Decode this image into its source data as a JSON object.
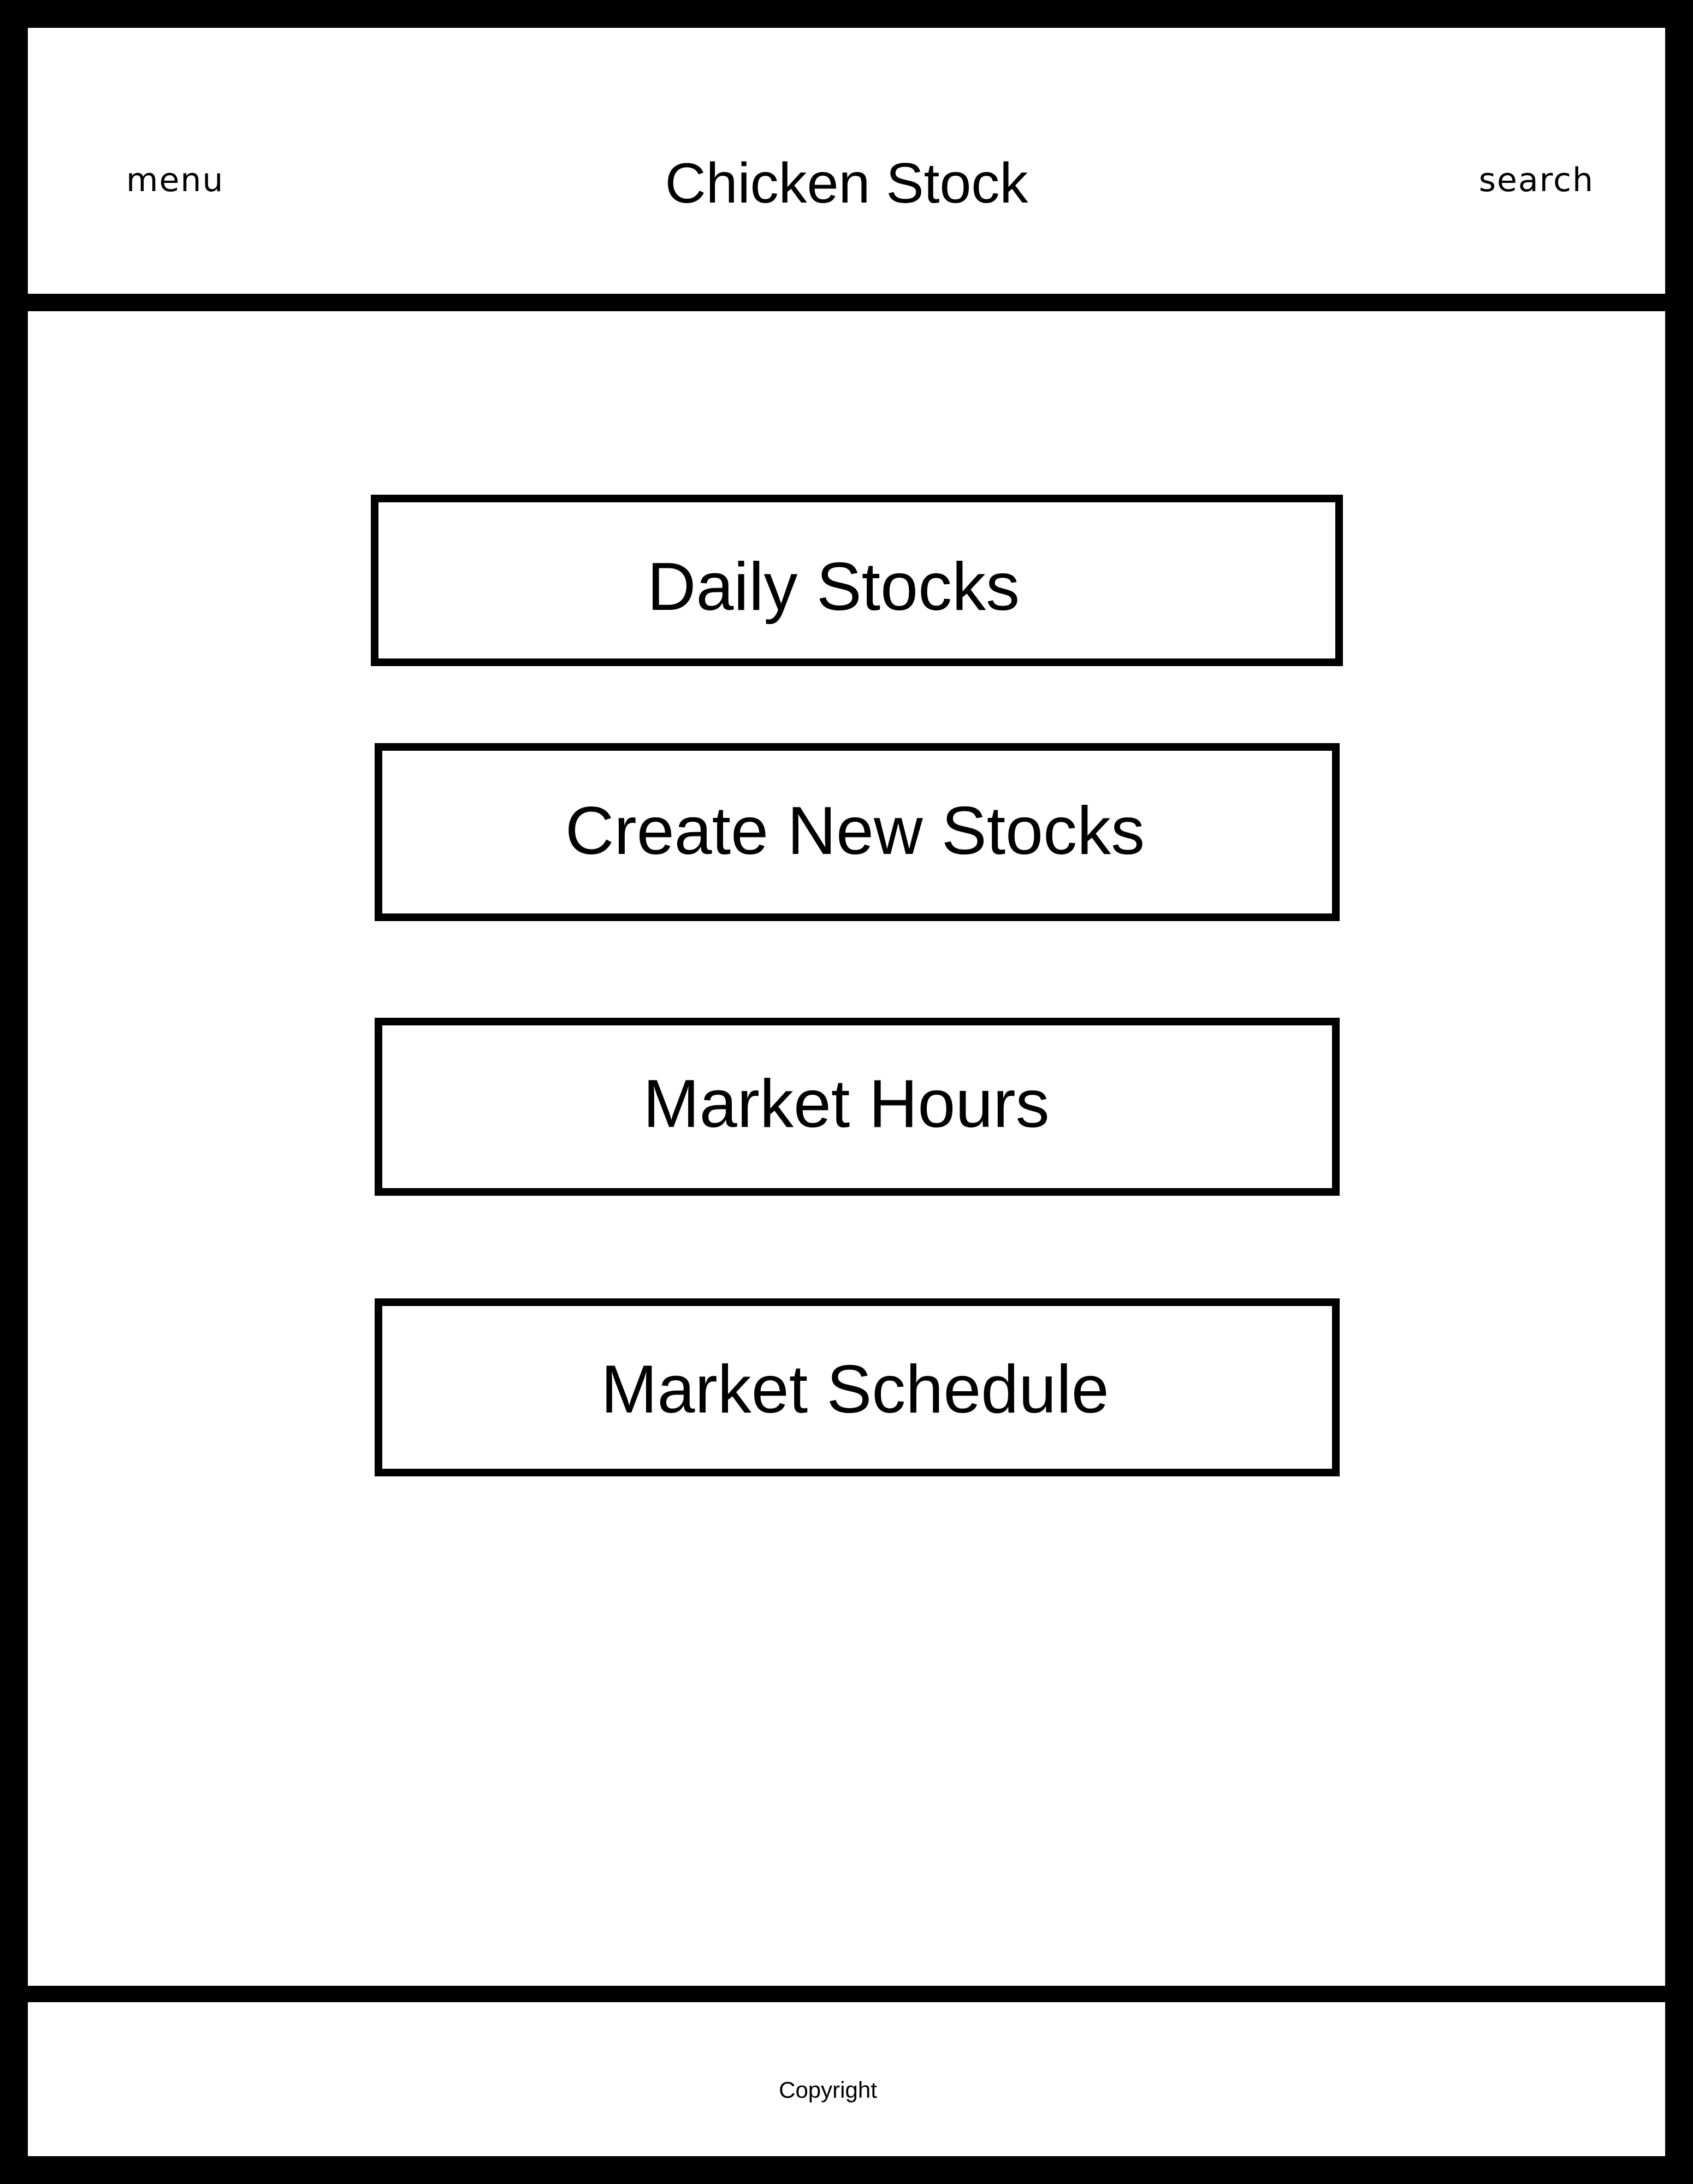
{
  "header": {
    "menu_label": "menu",
    "title": "Chicken Stock",
    "search_label": "search"
  },
  "main": {
    "buttons": [
      {
        "label": "Daily Stocks"
      },
      {
        "label": "Create New Stocks"
      },
      {
        "label": "Market Hours"
      },
      {
        "label": "Market Schedule"
      }
    ]
  },
  "footer": {
    "copyright": "Copyright"
  },
  "colors": {
    "border": "#000000",
    "background": "#ffffff",
    "text": "#000000"
  }
}
